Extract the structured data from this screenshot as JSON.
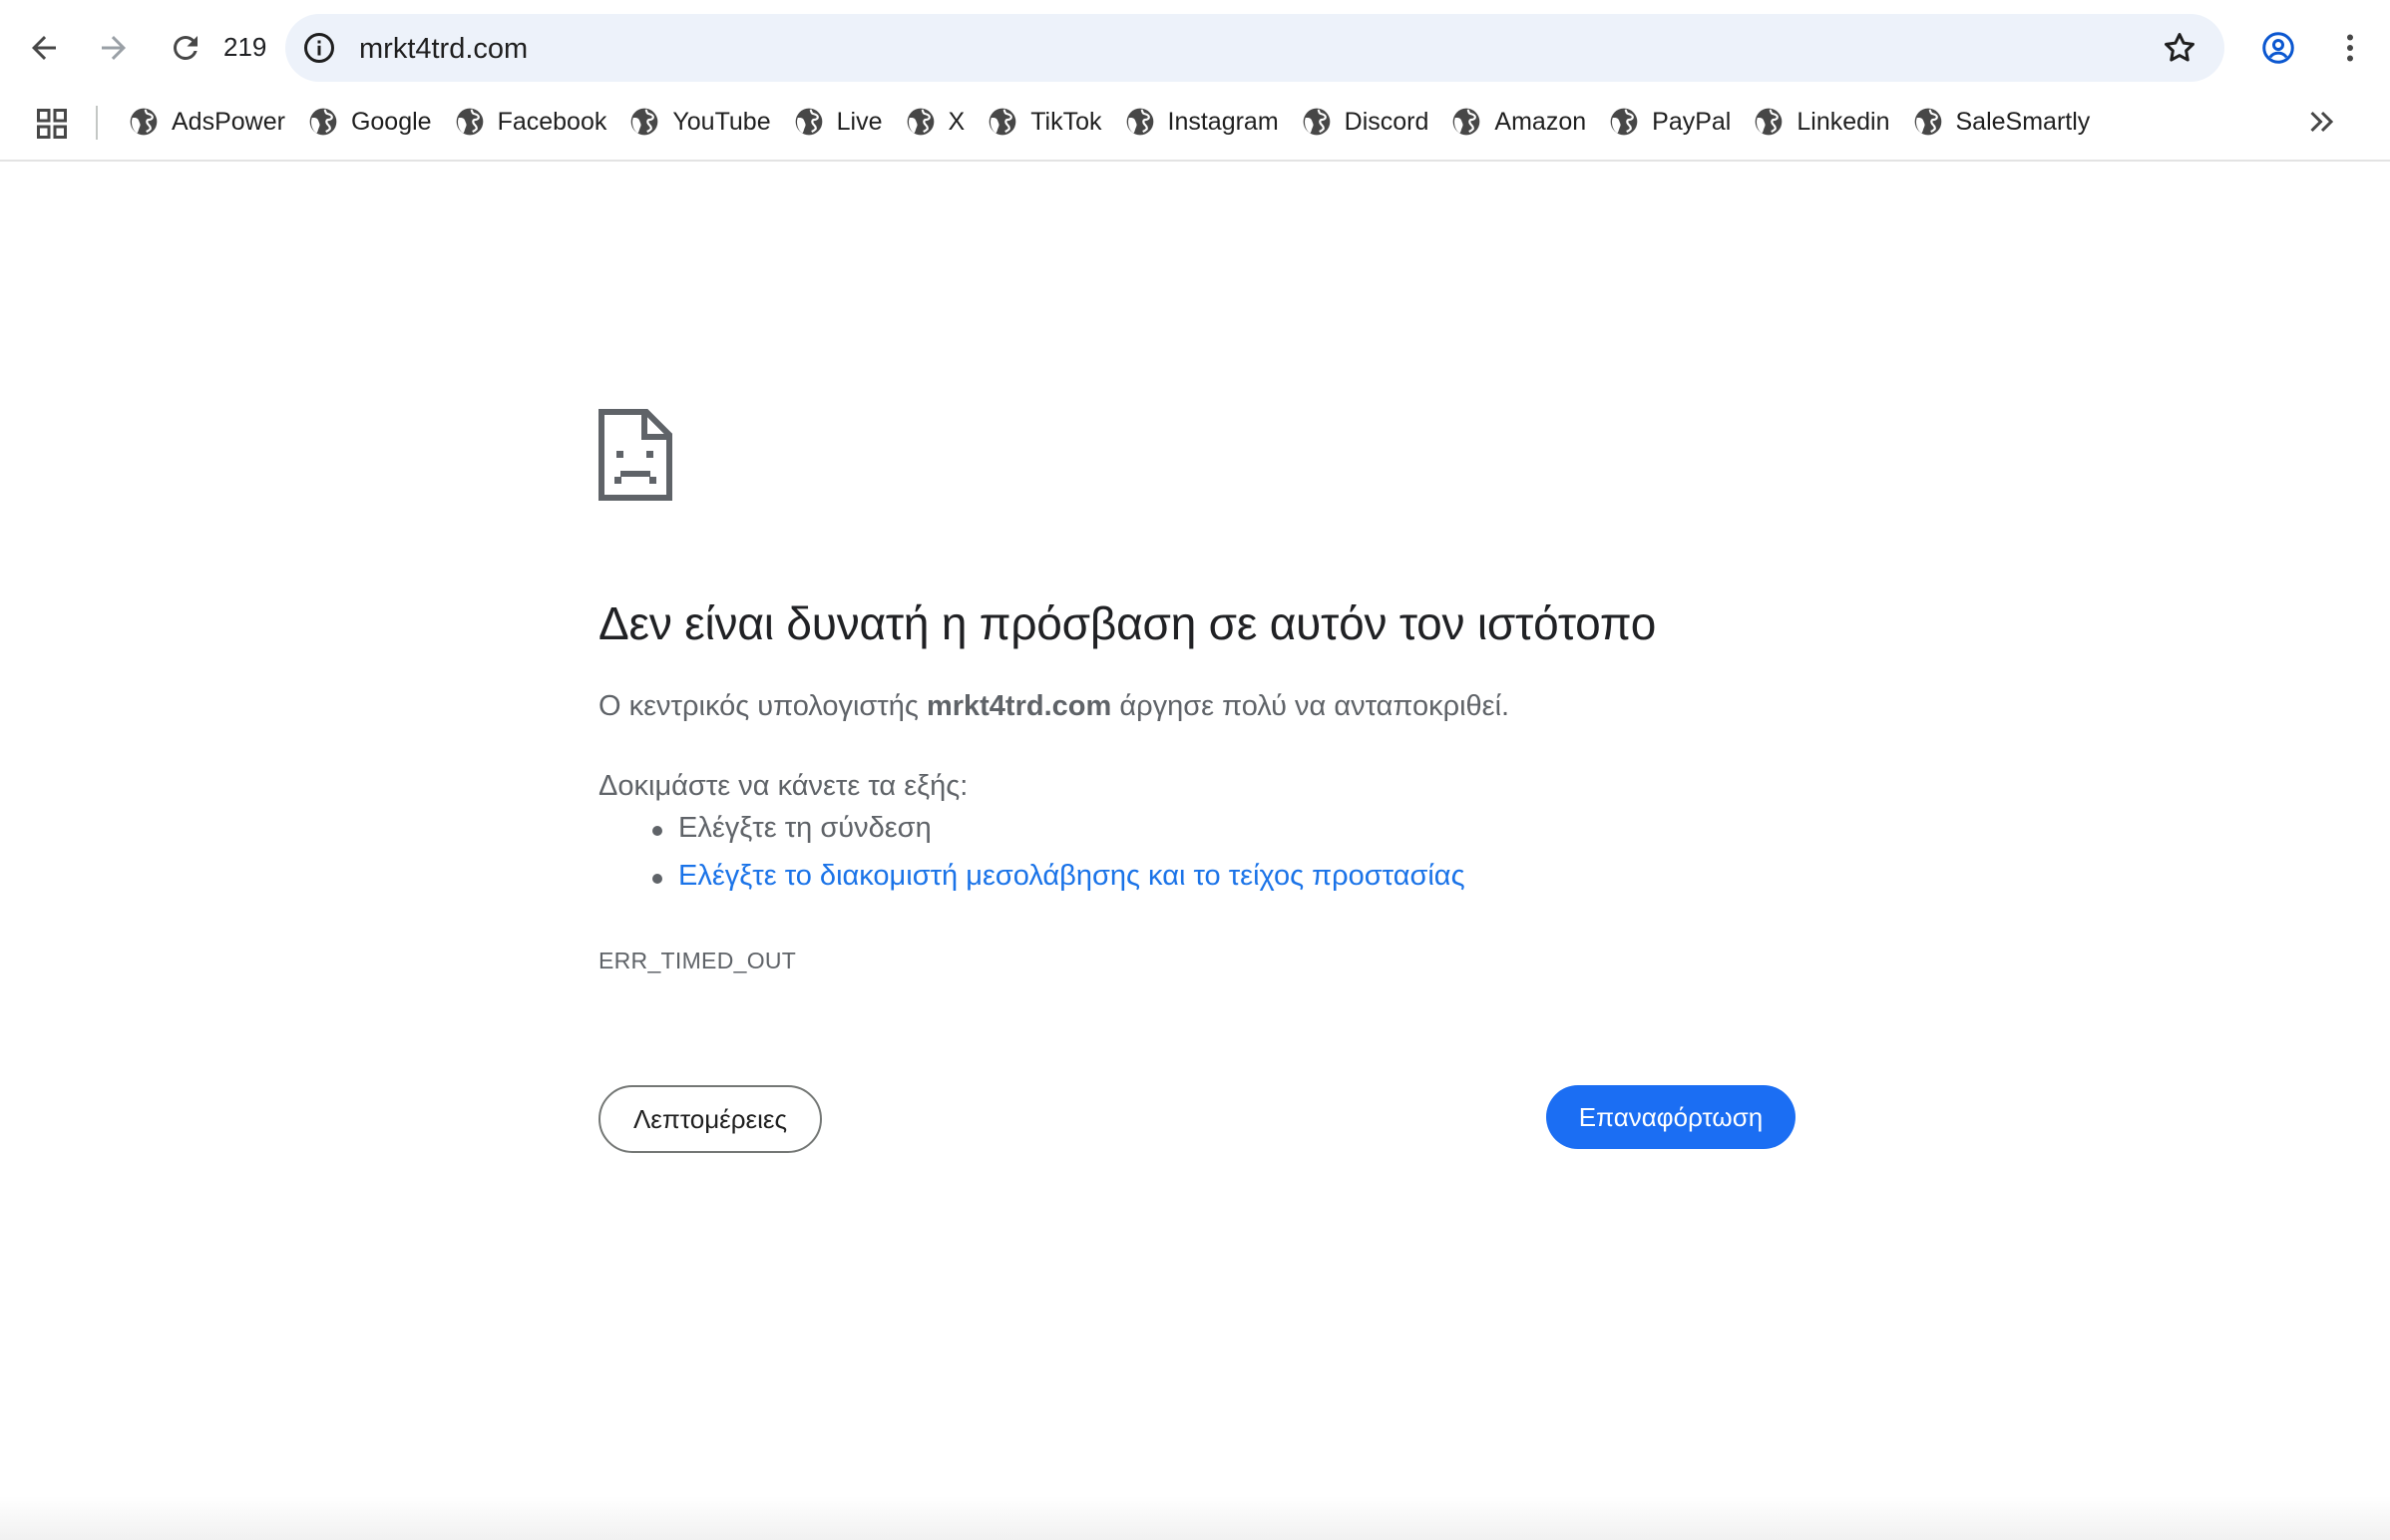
{
  "toolbar": {
    "back_icon": "arrow-left-icon",
    "forward_icon": "arrow-right-icon",
    "reload_icon": "reload-icon",
    "reload_count": "219",
    "address": "mrkt4trd.com",
    "site_info_icon": "info-icon",
    "bookmark_star_icon": "star-icon",
    "profile_icon": "account-circle-icon",
    "menu_icon": "kebab-menu-icon"
  },
  "bookmarks": {
    "apps_icon": "apps-grid-icon",
    "items": [
      {
        "label": "AdsPower"
      },
      {
        "label": "Google"
      },
      {
        "label": "Facebook"
      },
      {
        "label": "YouTube"
      },
      {
        "label": "Live"
      },
      {
        "label": "X"
      },
      {
        "label": "TikTok"
      },
      {
        "label": "Instagram"
      },
      {
        "label": "Discord"
      },
      {
        "label": "Amazon"
      },
      {
        "label": "PayPal"
      },
      {
        "label": "Linkedin"
      },
      {
        "label": "SaleSmartly"
      }
    ],
    "overflow_icon": "chevron-double-right-icon"
  },
  "error": {
    "icon": "sad-page-icon",
    "title": "Δεν είναι δυνατή η πρόσβαση σε αυτόν τον ιστότοπο",
    "desc_prefix": "Ο κεντρικός υπολογιστής ",
    "desc_host": "mrkt4trd.com",
    "desc_suffix": " άργησε πολύ να ανταποκριθεί.",
    "try_label": "Δοκιμάστε να κάνετε τα εξής:",
    "suggestions": [
      "Ελέγξτε τη σύνδεση",
      "Ελέγξτε το διακομιστή μεσολάβησης και το τείχος προστασίας"
    ],
    "code": "ERR_TIMED_OUT",
    "details_button": "Λεπτομέρειες",
    "reload_button": "Επαναφόρτωση"
  },
  "colors": {
    "link": "#1a73e8",
    "primary_button": "#1b6ef3",
    "omnibox_bg": "#edf2fa",
    "secondary_text": "#5f6368"
  }
}
